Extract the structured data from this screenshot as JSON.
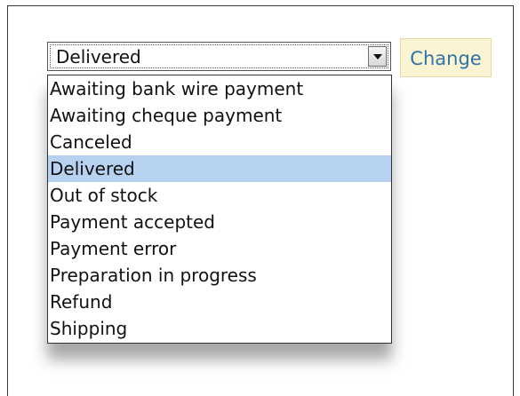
{
  "order_status": {
    "selected_value": "Delivered",
    "change_label": "Change",
    "selected_option": "Delivered",
    "options": [
      "Awaiting bank wire payment",
      "Awaiting cheque payment",
      "Canceled",
      "Delivered",
      "Out of stock",
      "Payment accepted",
      "Payment error",
      "Preparation in progress",
      "Refund",
      "Shipping"
    ]
  },
  "colors": {
    "selected_option_bg": "#b7d2f1",
    "button_bg": "#fbf4d2",
    "button_text": "#2e73a8"
  },
  "icons": {
    "dropdown_arrow": "chevron-down-icon"
  }
}
